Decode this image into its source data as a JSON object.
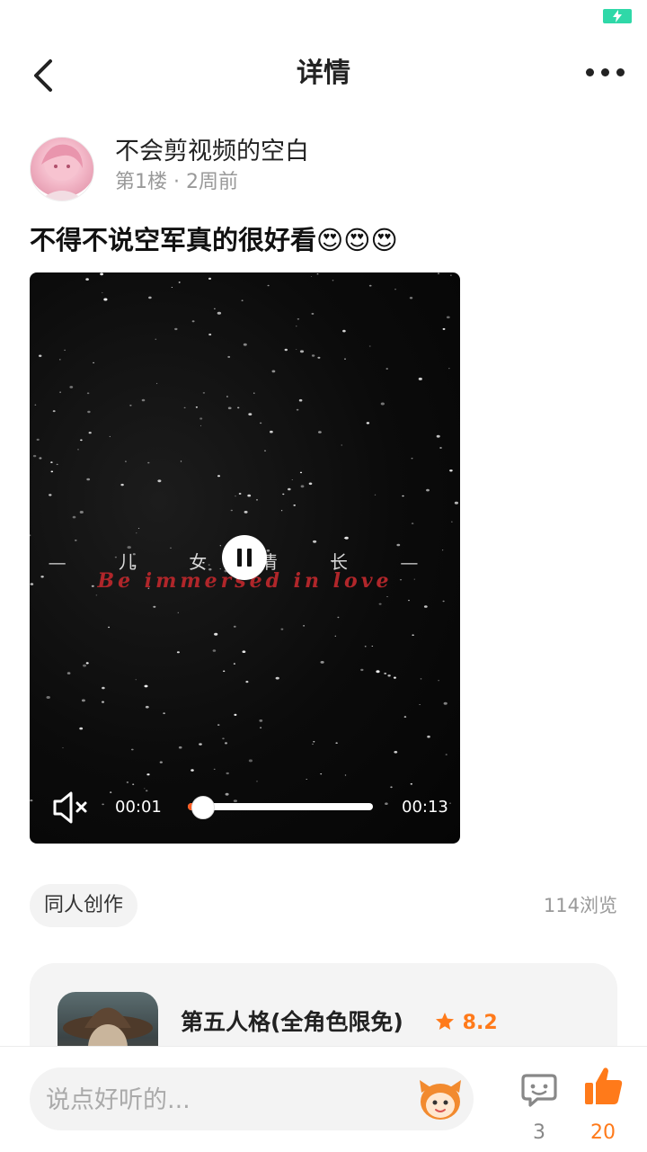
{
  "header": {
    "title": "详情",
    "back_icon": "chevron-left-icon",
    "more_icon": "more-dots-icon"
  },
  "post": {
    "author": "不会剪视频的空白",
    "floor": "第1楼",
    "time": "2周前",
    "text": "不得不说空军真的很好看😍😍😍"
  },
  "video": {
    "overlay_cn": "— 儿 女 情 长 —",
    "overlay_en": "Be immersed in love",
    "current_time": "00:01",
    "duration": "00:13",
    "progress": 0.08
  },
  "tag": "同人创作",
  "views": "114浏览",
  "game": {
    "title": "第五人格(全角色限免)",
    "rating": "8.2"
  },
  "bottom": {
    "input_placeholder": "说点好听的...",
    "comment_count": "3",
    "like_count": "20"
  },
  "colors": {
    "accent": "#ff7a1a",
    "battery": "#2fd8a8"
  }
}
